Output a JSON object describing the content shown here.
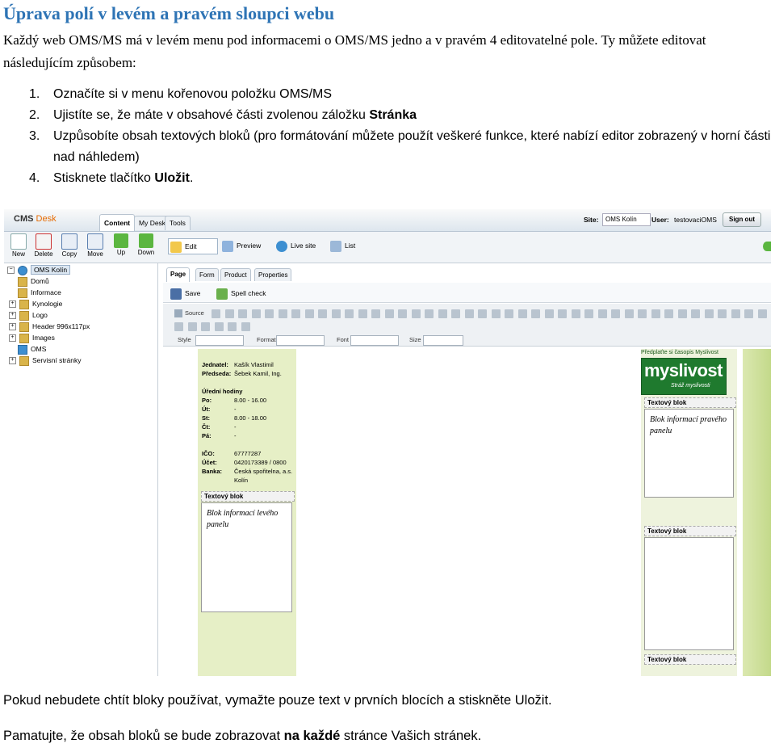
{
  "doc": {
    "title": "Úprava polí v levém a pravém sloupci webu",
    "intro": "Každý web OMS/MS má v levém menu pod informacemi o OMS/MS jedno a v pravém 4 editovatelné pole. Ty můžete editovat následujícím způsobem:",
    "steps": [
      {
        "num": "1.",
        "text": "Označíte si v menu kořenovou položku OMS/MS",
        "bold": ""
      },
      {
        "num": "2.",
        "text": "Ujistíte se, že máte v obsahové části zvolenou záložku ",
        "bold": "Stránka"
      },
      {
        "num": "3.",
        "text": "Uzpůsobíte obsah textových bloků (pro formátování můžete použít veškeré funkce, které nabízí editor zobrazený v horní části nad náhledem)",
        "bold": ""
      },
      {
        "num": "4.",
        "text": "Stisknete tlačítko ",
        "bold": "Uložit",
        "after": "."
      }
    ],
    "footer1": "Pokud nebudete chtít bloky používat, vymažte pouze text v prvních blocích a stiskněte Uložit.",
    "footer2_a": "Pamatujte, že obsah bloků se bude zobrazovat ",
    "footer2_b": "na každé",
    "footer2_c": " stránce Vašich stránek."
  },
  "shot": {
    "logo_a": "CMS",
    "logo_b": "Desk",
    "tabs": [
      "Content",
      "My Desk",
      "Tools"
    ],
    "site_label": "Site:",
    "site_value": "OMS Kolín",
    "user_label": "User:",
    "user_value": "testovaciOMS",
    "signout": "Sign out",
    "toolbar": [
      "New",
      "Delete",
      "Copy",
      "Move",
      "Up",
      "Down"
    ],
    "edit_modes": [
      "Edit",
      "Preview",
      "Live site",
      "List"
    ],
    "tree": [
      "OMS Kolín",
      "Domů",
      "Informace",
      "Kynologie",
      "Logo",
      "Header 996x117px",
      "Images",
      "OMS",
      "Servisní stránky"
    ],
    "subtabs": [
      "Page",
      "Form",
      "Product",
      "Properties"
    ],
    "save": "Save",
    "spell": "Spell check",
    "editor_source": "Source",
    "editor_labels": {
      "style": "Style",
      "format": "Format",
      "font": "Font",
      "size": "Size"
    },
    "left_info": [
      {
        "k": "Jednatel:",
        "v": "Kašík Vlastimil"
      },
      {
        "k": "Předseda:",
        "v": "Šebek Kamil, Ing."
      },
      {
        "k": "",
        "v": ""
      },
      {
        "k": "Úřední hodiny",
        "v": ""
      },
      {
        "k": "Po:",
        "v": "8.00 - 16.00"
      },
      {
        "k": "Út:",
        "v": "-"
      },
      {
        "k": "St:",
        "v": "8.00 - 18.00"
      },
      {
        "k": "Čt:",
        "v": "-"
      },
      {
        "k": "Pá:",
        "v": "-"
      },
      {
        "k": "",
        "v": ""
      },
      {
        "k": "IČO:",
        "v": "67777287"
      },
      {
        "k": "Účet:",
        "v": "0420173389 / 0800"
      },
      {
        "k": "Banka:",
        "v": "Česká spořitelna, a.s."
      },
      {
        "k": "",
        "v": "Kolín"
      }
    ],
    "block_title": "Textový blok",
    "left_block_text": "Blok informací levého panelu",
    "right_block_text": "Blok informací pravého panelu",
    "mys_link": "Předplaťte si časopis Myslivost",
    "mys_big": "myslivost",
    "mys_small": "Stráž myslivosti"
  }
}
